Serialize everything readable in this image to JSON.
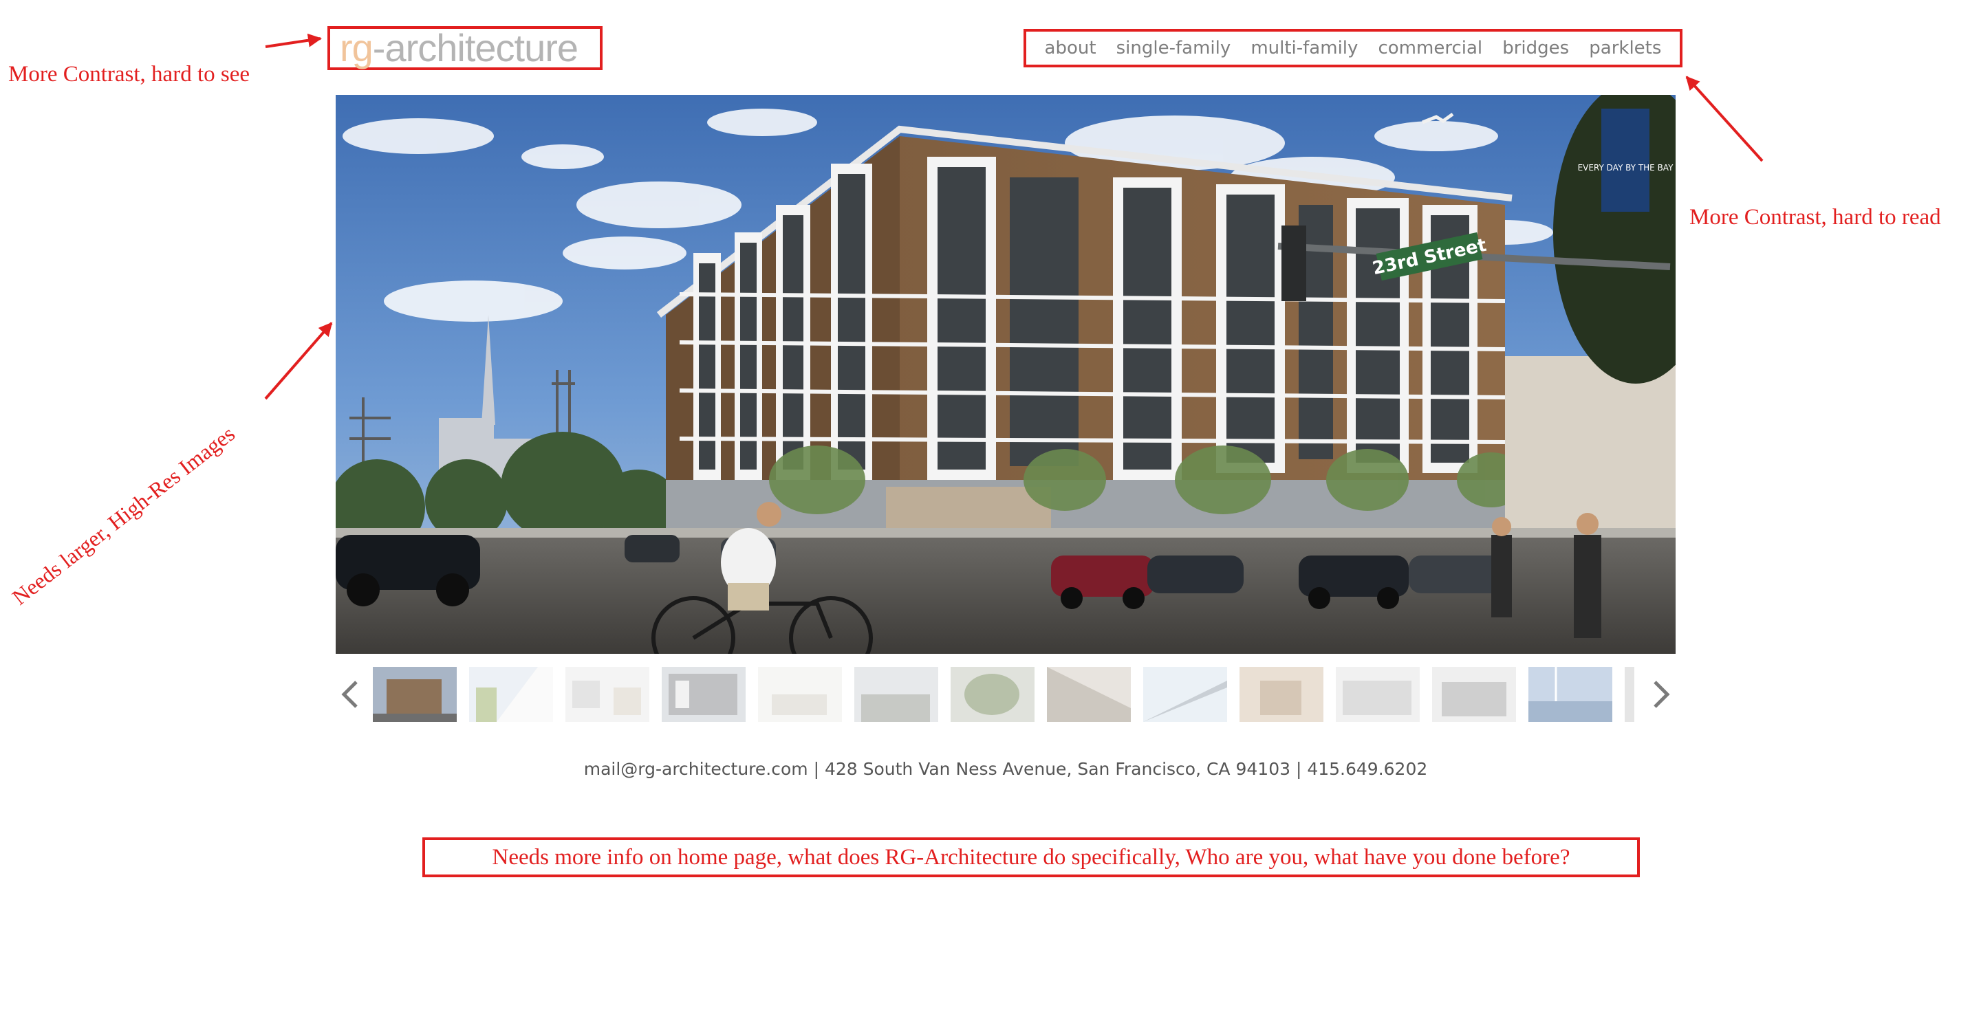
{
  "brand": {
    "logo_prefix": "rg",
    "logo_suffix": "-architecture",
    "logo_prefix_color": "#f1c49b",
    "logo_suffix_color": "#b4b4b4"
  },
  "nav": {
    "items": [
      {
        "label": "about"
      },
      {
        "label": "single-family"
      },
      {
        "label": "multi-family"
      },
      {
        "label": "commercial"
      },
      {
        "label": "bridges"
      },
      {
        "label": "parklets"
      }
    ]
  },
  "hero": {
    "street_sign": "23rd Street",
    "banner_text": "EVERY DAY BY THE BAY"
  },
  "carousel": {
    "prev_icon": "chevron-left-icon",
    "next_icon": "chevron-right-icon",
    "thumbnail_count": 14
  },
  "footer": {
    "contact": "mail@rg-architecture.com | 428 South Van Ness Avenue, San Francisco, CA 94103 | 415.649.6202"
  },
  "annotations": {
    "logo_note": "More Contrast, hard to see",
    "nav_note": "More Contrast, hard to read",
    "image_note": "Needs larger, High-Res Images",
    "info_note": "Needs more info on home page, what does RG-Architecture do specifically, Who are you, what have you done before?",
    "annotation_color": "#e21f1f"
  }
}
